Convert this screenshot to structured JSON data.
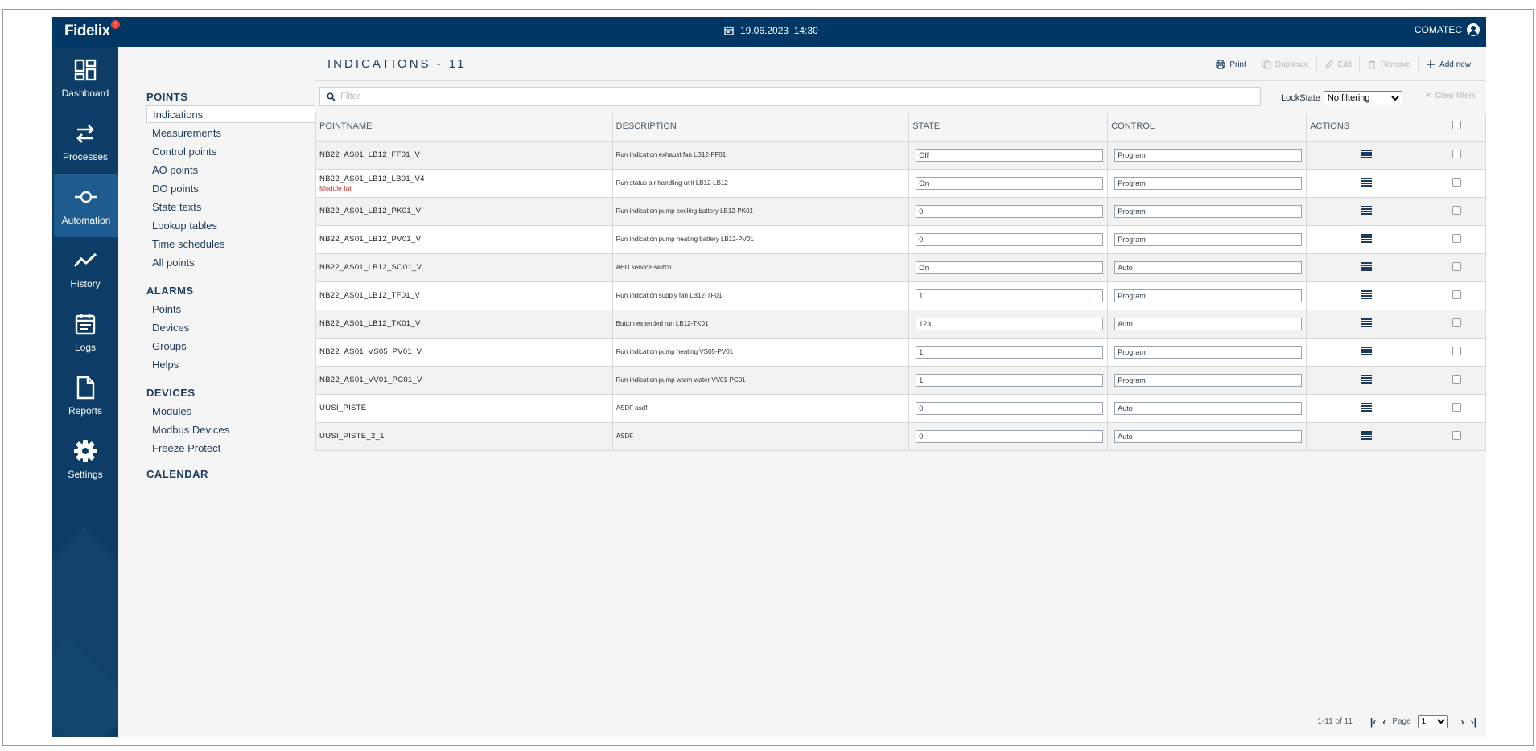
{
  "app": {
    "brand": "Fidelix",
    "notification_count": "!",
    "datetime": "19.06.2023  14:30",
    "user": "COMATEC"
  },
  "nav": [
    {
      "label": "Dashboard",
      "icon": "dashboard-icon"
    },
    {
      "label": "Processes",
      "icon": "processes-icon"
    },
    {
      "label": "Automation",
      "icon": "automation-icon",
      "active": true
    },
    {
      "label": "History",
      "icon": "history-icon"
    },
    {
      "label": "Logs",
      "icon": "logs-icon"
    },
    {
      "label": "Reports",
      "icon": "reports-icon"
    },
    {
      "label": "Settings",
      "icon": "settings-icon"
    }
  ],
  "submenu": {
    "points": {
      "title": "POINTS",
      "items": [
        "Indications",
        "Measurements",
        "Control points",
        "AO points",
        "DO points",
        "State texts",
        "Lookup tables",
        "Time schedules",
        "All points"
      ]
    },
    "alarms": {
      "title": "ALARMS",
      "items": [
        "Points",
        "Devices",
        "Groups",
        "Helps"
      ]
    },
    "devices": {
      "title": "DEVICES",
      "items": [
        "Modules",
        "Modbus Devices",
        "Freeze Protect"
      ]
    },
    "calendar": {
      "title": "CALENDAR"
    }
  },
  "page": {
    "title": "INDICATIONS - 11"
  },
  "toolbar": {
    "print": "Print",
    "duplicate": "Duplicate",
    "edit": "Edit",
    "remove": "Remove",
    "add_new": "Add new"
  },
  "filter": {
    "placeholder": "Filter",
    "lockstate_label": "LockState",
    "lockstate_value": "No filtering",
    "clear_filters": "Clear filters"
  },
  "table": {
    "headers": [
      "POINTNAME",
      "DESCRIPTION",
      "STATE",
      "CONTROL",
      "ACTIONS"
    ],
    "rows": [
      {
        "name": "NB22_AS01_LB12_FF01_V",
        "error": "",
        "description": "Run indication exhaust fan LB12-FF01",
        "state": "Off",
        "control": "Program"
      },
      {
        "name": "NB22_AS01_LB12_LB01_V4",
        "error": "Module fail",
        "description": "Run status air handling unit LB12-LB12",
        "state": "On",
        "control": "Program"
      },
      {
        "name": "NB22_AS01_LB12_PK01_V",
        "error": "",
        "description": "Run indication pump cooling battery LB12-PK01",
        "state": "0",
        "control": "Program"
      },
      {
        "name": "NB22_AS01_LB12_PV01_V",
        "error": "",
        "description": "Run indication pump heating battery LB12-PV01",
        "state": "0",
        "control": "Program"
      },
      {
        "name": "NB22_AS01_LB12_SO01_V",
        "error": "",
        "description": "AHU service switch",
        "state": "On",
        "control": "Auto"
      },
      {
        "name": "NB22_AS01_LB12_TF01_V",
        "error": "",
        "description": "Run indication supply fan LB12-TF01",
        "state": "1",
        "control": "Program"
      },
      {
        "name": "NB22_AS01_LB12_TK01_V",
        "error": "",
        "description": "Button extended run LB12-TK01",
        "state": "123",
        "control": "Auto"
      },
      {
        "name": "NB22_AS01_VS05_PV01_V",
        "error": "",
        "description": "Run indication pump heating VS05-PV01",
        "state": "1",
        "control": "Program"
      },
      {
        "name": "NB22_AS01_VV01_PC01_V",
        "error": "",
        "description": "Run indication pump warm water VV01-PC01",
        "state": "1",
        "control": "Program"
      },
      {
        "name": "UUSI_PISTE",
        "error": "",
        "description": "ASDF asdf",
        "state": "0",
        "control": "Auto"
      },
      {
        "name": "UUSI_PISTE_2_1",
        "error": "",
        "description": "ASDF",
        "state": "0",
        "control": "Auto"
      }
    ]
  },
  "pagination": {
    "range": "1-11 of 11",
    "page_label": "Page",
    "page_value": "1"
  }
}
